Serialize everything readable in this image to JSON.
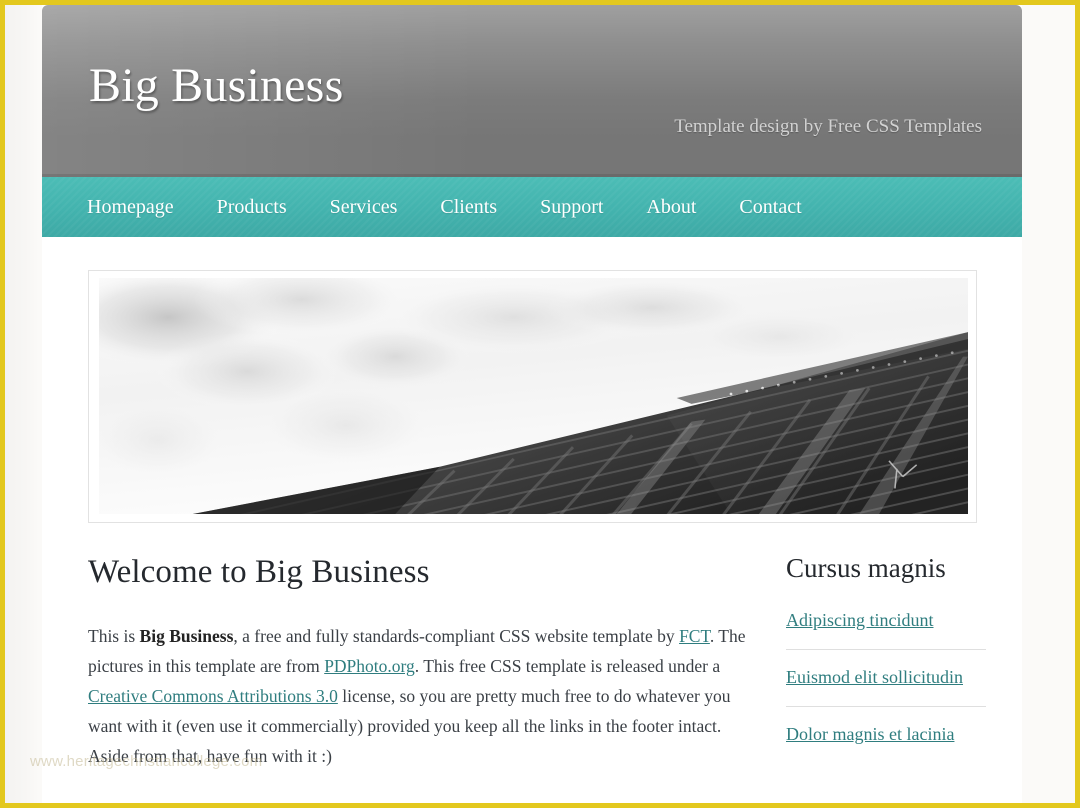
{
  "site": {
    "title": "Big Business",
    "tagline": "Template design by Free CSS Templates"
  },
  "nav": {
    "items": [
      {
        "label": "Homepage"
      },
      {
        "label": "Products"
      },
      {
        "label": "Services"
      },
      {
        "label": "Clients"
      },
      {
        "label": "Support"
      },
      {
        "label": "About"
      },
      {
        "label": "Contact"
      }
    ]
  },
  "banner": {
    "alt": "Black and white photograph of a skyscraper seen from below against a cloudy sky"
  },
  "main": {
    "heading": "Welcome to Big Business",
    "paragraph": {
      "part1": "This is ",
      "bold1": "Big Business",
      "part2": ", a free and fully standards-compliant CSS website template by ",
      "link1": "FCT",
      "part3": ". The pictures in this template are from ",
      "link2": "PDPhoto.org",
      "part4": ". This free CSS template is released under a ",
      "link3": "Creative Commons Attributions 3.0",
      "part5": " license, so you are pretty much free to do whatever you want with it (even use it commercially) provided you keep all the links in the footer intact. Aside from that, have fun with it :)"
    }
  },
  "sidebar": {
    "heading": "Cursus magnis",
    "links": [
      {
        "label": "Adipiscing tincidunt"
      },
      {
        "label": "Euismod elit sollicitudin"
      },
      {
        "label": "Dolor magnis et lacinia"
      }
    ]
  },
  "watermark": {
    "text": "www.heritagechristiancollege.com"
  },
  "colors": {
    "nav_teal": "#43b3ae",
    "header_gray": "#767676",
    "link_teal": "#2f7d7f",
    "focus_border": "#e3c81e",
    "page_background": "#ffffff"
  }
}
